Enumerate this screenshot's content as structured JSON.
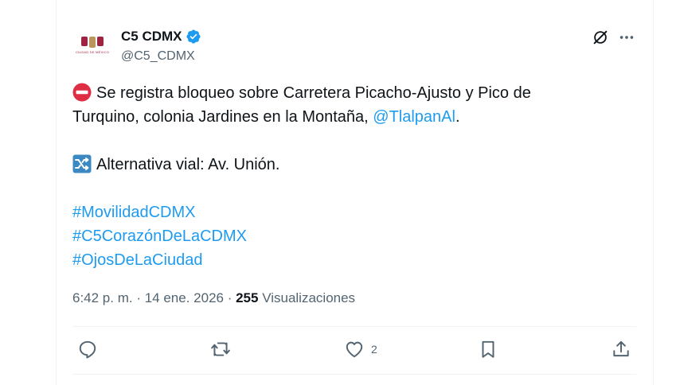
{
  "author": {
    "name": "C5 CDMX",
    "handle": "@C5_CDMX",
    "avatar_text": "CIUDAD DE MÉXICO"
  },
  "icons": {
    "verified": "verified-badge-icon",
    "grok": "grok-icon",
    "more": "more-options-icon",
    "no_entry": "no-entry-emoji",
    "shuffle": "shuffle-emoji"
  },
  "tweet": {
    "line1_text": "Se registra bloqueo sobre Carretera Picacho-Ajusto y Pico de",
    "line2_text": "Turquino, colonia Jardines en la Montaña, ",
    "mention": "@TlalpanAl",
    "line2_end": ".",
    "alt_text": "Alternativa vial: Av. Unión.",
    "hashtags": [
      "#MovilidadCDMX",
      "#C5CorazónDeLaCDMX",
      "#OjosDeLaCiudad"
    ]
  },
  "meta": {
    "time": "6:42 p. m.",
    "sep1": " · ",
    "date": "14 ene. 2026",
    "sep2": " · ",
    "views_count": "255",
    "views_label": " Visualizaciones"
  },
  "actions": {
    "like_count": "2"
  },
  "colors": {
    "link": "#1d9bf0",
    "verified": "#1d9bf0",
    "secondary_text": "#536471",
    "no_entry": "#dd2e44",
    "shuffle_bg": "#3b88c3"
  }
}
